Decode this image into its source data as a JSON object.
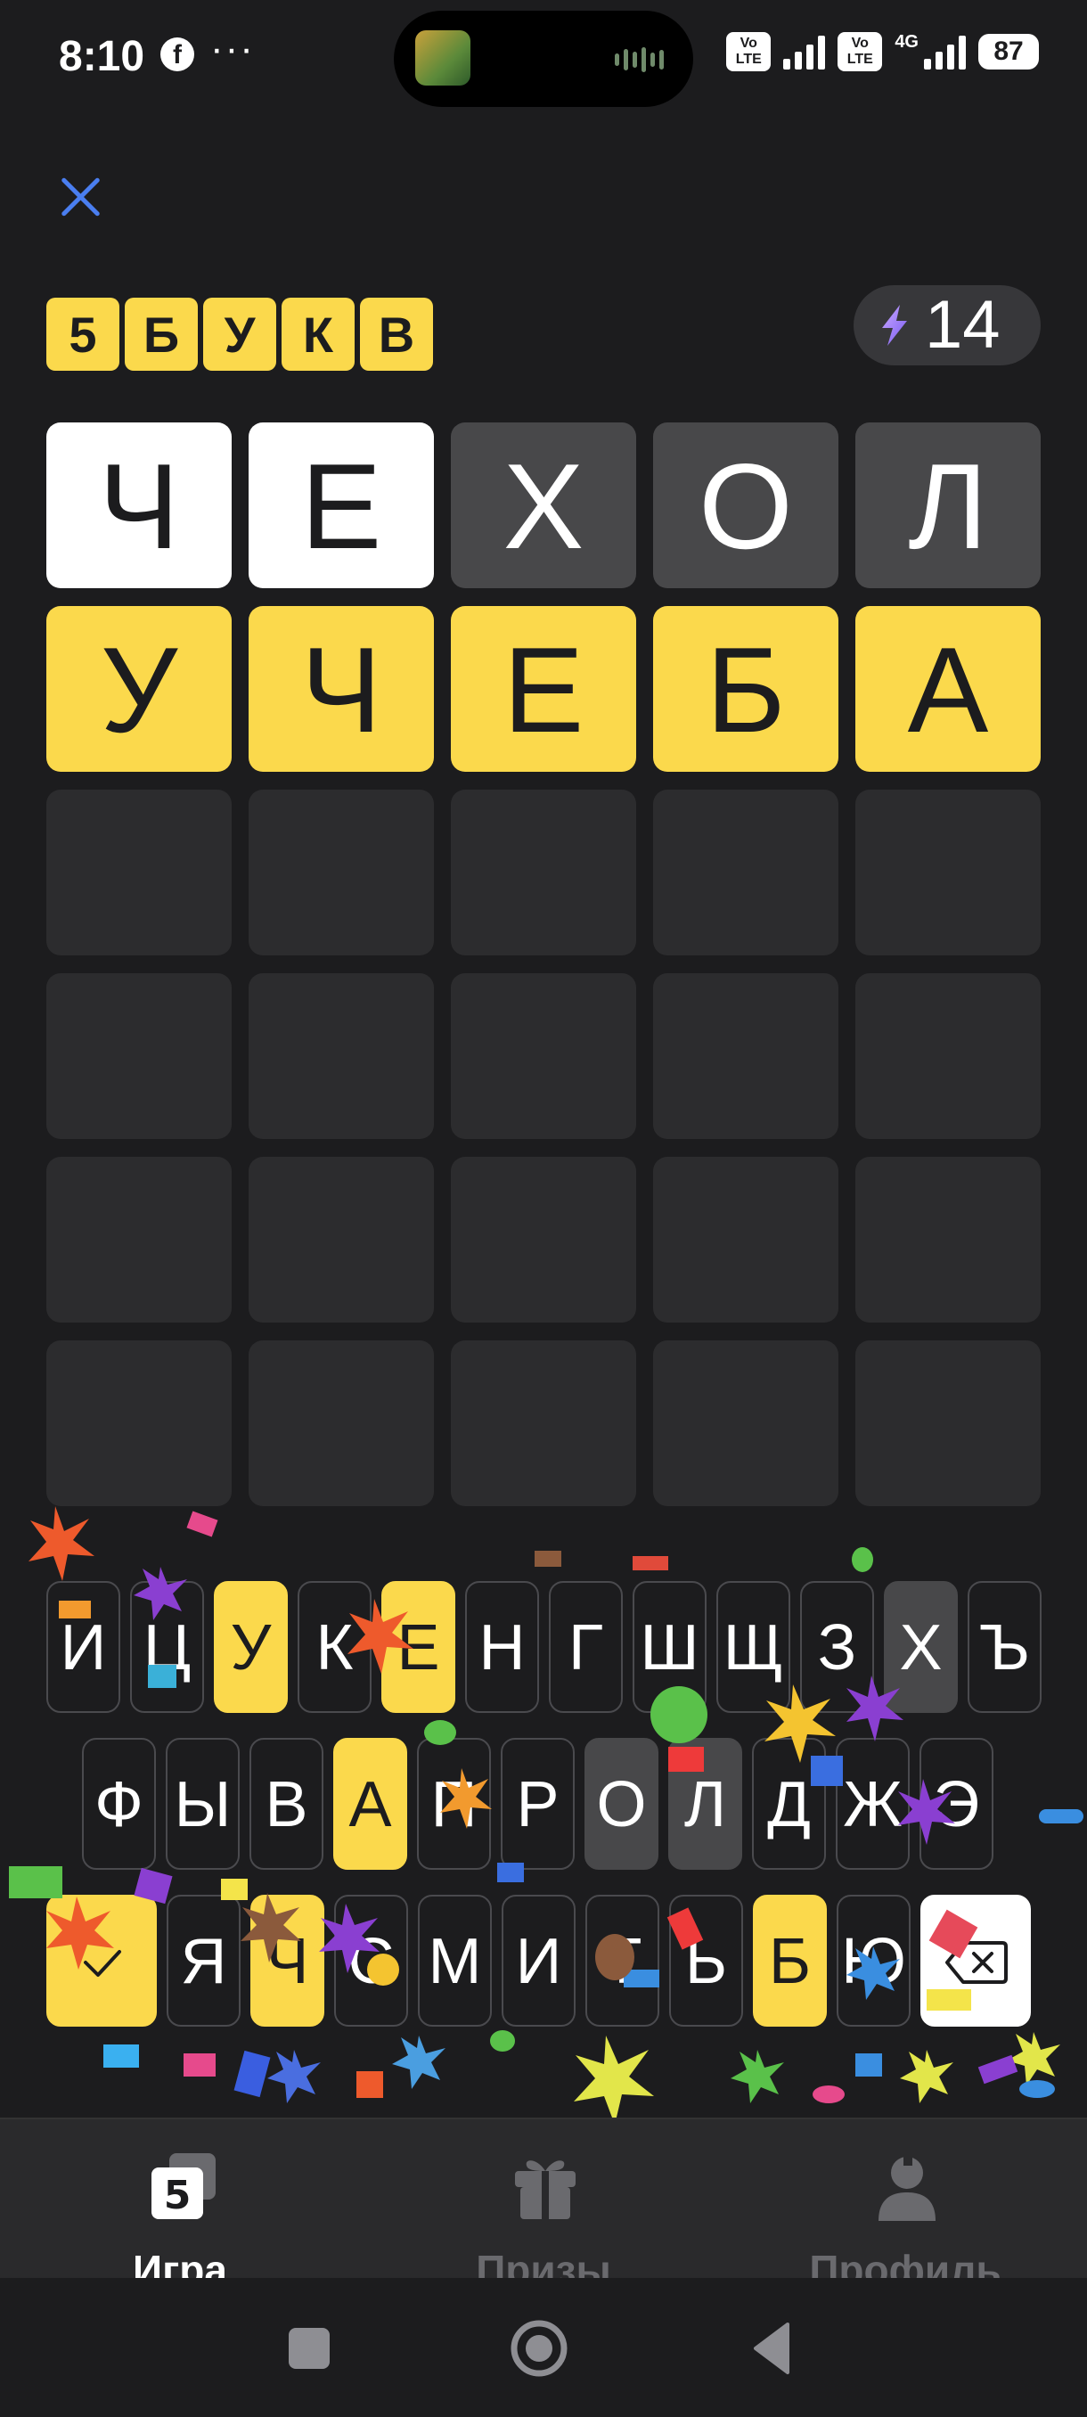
{
  "status_bar": {
    "time": "8:10",
    "app_icon": "f",
    "more": "···",
    "volte_1": "Vo LTE",
    "volte_2": "Vo LTE",
    "network": "4G",
    "battery": "87"
  },
  "header": {
    "close_icon": "close-icon",
    "logo_letters": [
      "5",
      "Б",
      "У",
      "К",
      "В"
    ],
    "energy_count": "14"
  },
  "grid": {
    "rows": [
      [
        {
          "letter": "Ч",
          "state": "present"
        },
        {
          "letter": "Е",
          "state": "present"
        },
        {
          "letter": "Х",
          "state": "absent"
        },
        {
          "letter": "О",
          "state": "absent"
        },
        {
          "letter": "Л",
          "state": "absent"
        }
      ],
      [
        {
          "letter": "У",
          "state": "correct"
        },
        {
          "letter": "Ч",
          "state": "correct"
        },
        {
          "letter": "Е",
          "state": "correct"
        },
        {
          "letter": "Б",
          "state": "correct"
        },
        {
          "letter": "А",
          "state": "correct"
        }
      ],
      [
        {
          "letter": "",
          "state": "empty"
        },
        {
          "letter": "",
          "state": "empty"
        },
        {
          "letter": "",
          "state": "empty"
        },
        {
          "letter": "",
          "state": "empty"
        },
        {
          "letter": "",
          "state": "empty"
        }
      ],
      [
        {
          "letter": "",
          "state": "empty"
        },
        {
          "letter": "",
          "state": "empty"
        },
        {
          "letter": "",
          "state": "empty"
        },
        {
          "letter": "",
          "state": "empty"
        },
        {
          "letter": "",
          "state": "empty"
        }
      ],
      [
        {
          "letter": "",
          "state": "empty"
        },
        {
          "letter": "",
          "state": "empty"
        },
        {
          "letter": "",
          "state": "empty"
        },
        {
          "letter": "",
          "state": "empty"
        },
        {
          "letter": "",
          "state": "empty"
        }
      ],
      [
        {
          "letter": "",
          "state": "empty"
        },
        {
          "letter": "",
          "state": "empty"
        },
        {
          "letter": "",
          "state": "empty"
        },
        {
          "letter": "",
          "state": "empty"
        },
        {
          "letter": "",
          "state": "empty"
        }
      ]
    ]
  },
  "keyboard": {
    "row1": [
      {
        "k": "И",
        "s": "default"
      },
      {
        "k": "Ц",
        "s": "default"
      },
      {
        "k": "У",
        "s": "correct"
      },
      {
        "k": "К",
        "s": "default"
      },
      {
        "k": "Е",
        "s": "correct"
      },
      {
        "k": "Н",
        "s": "default"
      },
      {
        "k": "Г",
        "s": "default"
      },
      {
        "k": "Ш",
        "s": "default"
      },
      {
        "k": "Щ",
        "s": "default"
      },
      {
        "k": "З",
        "s": "default"
      },
      {
        "k": "Х",
        "s": "absent"
      },
      {
        "k": "Ъ",
        "s": "default"
      }
    ],
    "row2": [
      {
        "k": "Ф",
        "s": "default"
      },
      {
        "k": "Ы",
        "s": "default"
      },
      {
        "k": "В",
        "s": "default"
      },
      {
        "k": "А",
        "s": "correct"
      },
      {
        "k": "П",
        "s": "default"
      },
      {
        "k": "Р",
        "s": "default"
      },
      {
        "k": "О",
        "s": "absent"
      },
      {
        "k": "Л",
        "s": "absent"
      },
      {
        "k": "Д",
        "s": "default"
      },
      {
        "k": "Ж",
        "s": "default"
      },
      {
        "k": "Э",
        "s": "default"
      }
    ],
    "row3": [
      {
        "k": "Я",
        "s": "default"
      },
      {
        "k": "Ч",
        "s": "correct"
      },
      {
        "k": "С",
        "s": "default"
      },
      {
        "k": "М",
        "s": "default"
      },
      {
        "k": "И",
        "s": "default"
      },
      {
        "k": "Т",
        "s": "default"
      },
      {
        "k": "Ь",
        "s": "default"
      },
      {
        "k": "Б",
        "s": "correct"
      },
      {
        "k": "Ю",
        "s": "default"
      }
    ],
    "enter_icon": "check-icon",
    "backspace_icon": "backspace-icon"
  },
  "bottom_nav": {
    "items": [
      {
        "label": "Игра",
        "icon": "game-icon",
        "active": true
      },
      {
        "label": "Призы",
        "icon": "gift-icon",
        "active": false
      },
      {
        "label": "Профиль",
        "icon": "profile-icon",
        "active": false
      }
    ]
  },
  "colors": {
    "background": "#1c1c1e",
    "correct": "#fbd94c",
    "present": "#ffffff",
    "absent": "#48484a",
    "empty": "#2c2c2e",
    "accent_close": "#4a7ef0"
  },
  "system_nav": {
    "recents_icon": "square-icon",
    "home_icon": "home-circle-icon",
    "back_icon": "back-triangle-icon"
  }
}
